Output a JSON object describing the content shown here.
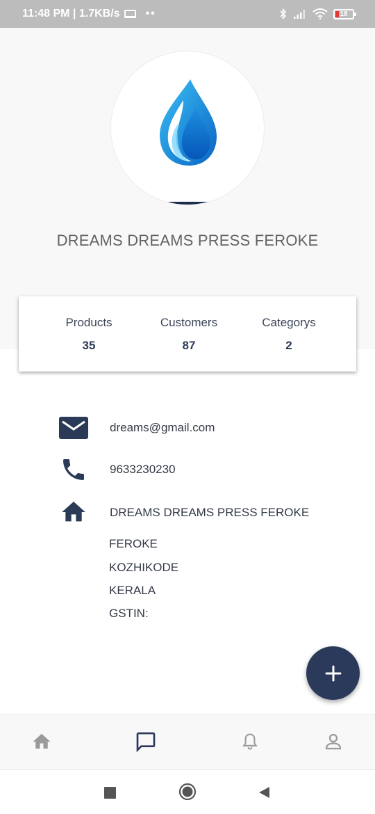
{
  "status_bar": {
    "time_speed": "11:48 PM | 1.7KB/s",
    "dots": "••",
    "battery": "18"
  },
  "profile": {
    "business_name": "DREAMS DREAMS PRESS FEROKE",
    "logo_icon": "water-drop-logo"
  },
  "stats": {
    "products_label": "Products",
    "products_value": "35",
    "customers_label": "Customers",
    "customers_value": "87",
    "categorys_label": "Categorys",
    "categorys_value": "2"
  },
  "contact": {
    "email": "dreams@gmail.com",
    "phone": "9633230230",
    "address_name": "DREAMS DREAMS PRESS FEROKE",
    "address_lines": [
      "FEROKE",
      "KOZHIKODE",
      "KERALA",
      "GSTIN:"
    ]
  },
  "fab": {
    "label": "+"
  },
  "colors": {
    "primary": "#2b3a5b",
    "icon_active": "#2b3a5b",
    "icon_inactive": "#9a9a9a",
    "header_bg": "#f8f8f9"
  },
  "bottom_nav": {
    "items": [
      {
        "icon": "home-icon",
        "active": false
      },
      {
        "icon": "chat-icon",
        "active": true
      },
      {
        "icon": "bell-icon",
        "active": false
      },
      {
        "icon": "profile-icon",
        "active": false
      }
    ]
  }
}
